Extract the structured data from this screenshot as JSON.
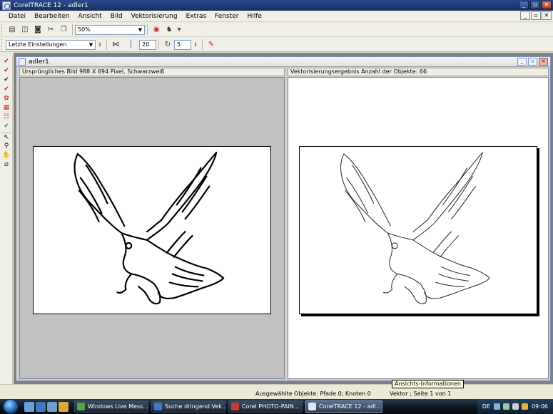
{
  "app": {
    "title": "CorelTRACE 12 - adler1"
  },
  "menu": [
    "Datei",
    "Bearbeiten",
    "Ansicht",
    "Bild",
    "Vektorisierung",
    "Extras",
    "Fenster",
    "Hilfe"
  ],
  "toolbar1": {
    "zoom": "50%"
  },
  "toolbar2": {
    "preset": "Letzte Einstellungen",
    "smoothing": "20",
    "iterations": "5"
  },
  "document": {
    "title": "adler1",
    "left_header": "Ursprüngliches Bild   988 X 694 Pixel, Schwarzweiß",
    "right_header": "Vektorisierungsergebnis   Anzahl der Objekte: 66"
  },
  "status": {
    "selected": "Ausgewählte Objekte: Pfade 0; Knoten 0",
    "page": "Vektor ; Seite 1 von 1",
    "tooltip": "Ansichts-Informationen"
  },
  "taskbar": {
    "tasks": [
      "Windows Live Mess...",
      "Suche dringend Vek...",
      "Corel PHOTO-PAIN...",
      "CorelTRACE 12 - adl..."
    ],
    "lang": "DE",
    "clock": "09:06"
  },
  "colors": {
    "titlebar": "#1e3a74",
    "workspace": "#808080",
    "left_pane": "#c0c0c0"
  }
}
